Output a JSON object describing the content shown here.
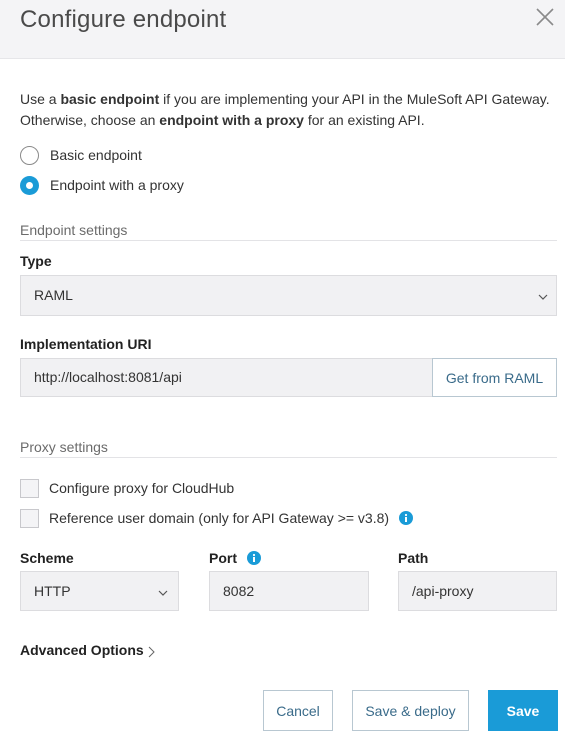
{
  "dialog": {
    "title": "Configure endpoint",
    "close_icon": "close-icon"
  },
  "intro": {
    "part1": "Use a ",
    "bold1": "basic endpoint",
    "part2": " if you are implementing your API in the MuleSoft API Gateway. Otherwise, choose an ",
    "bold2": "endpoint with a proxy",
    "part3": " for an existing API."
  },
  "endpoint_type": {
    "options": [
      {
        "label": "Basic endpoint",
        "selected": false
      },
      {
        "label": "Endpoint with a proxy",
        "selected": true
      }
    ]
  },
  "endpoint_settings": {
    "title": "Endpoint settings",
    "type_label": "Type",
    "type_value": "RAML",
    "impl_uri_label": "Implementation URI",
    "impl_uri_value": "http://localhost:8081/api",
    "get_from_raml_label": "Get from RAML"
  },
  "proxy_settings": {
    "title": "Proxy settings",
    "cloudhub_label": "Configure proxy for CloudHub",
    "cloudhub_checked": false,
    "user_domain_label": "Reference user domain (only for API Gateway >= v3.8)",
    "user_domain_checked": false,
    "scheme_label": "Scheme",
    "scheme_value": "HTTP",
    "port_label": "Port",
    "port_value": "8082",
    "path_label": "Path",
    "path_value": "/api-proxy"
  },
  "advanced_options_label": "Advanced Options",
  "footer": {
    "cancel_label": "Cancel",
    "save_deploy_label": "Save & deploy",
    "save_label": "Save"
  },
  "colors": {
    "accent": "#1a9bd7",
    "header_bg": "#f4f4f6",
    "field_bg": "#f1f1f3"
  }
}
